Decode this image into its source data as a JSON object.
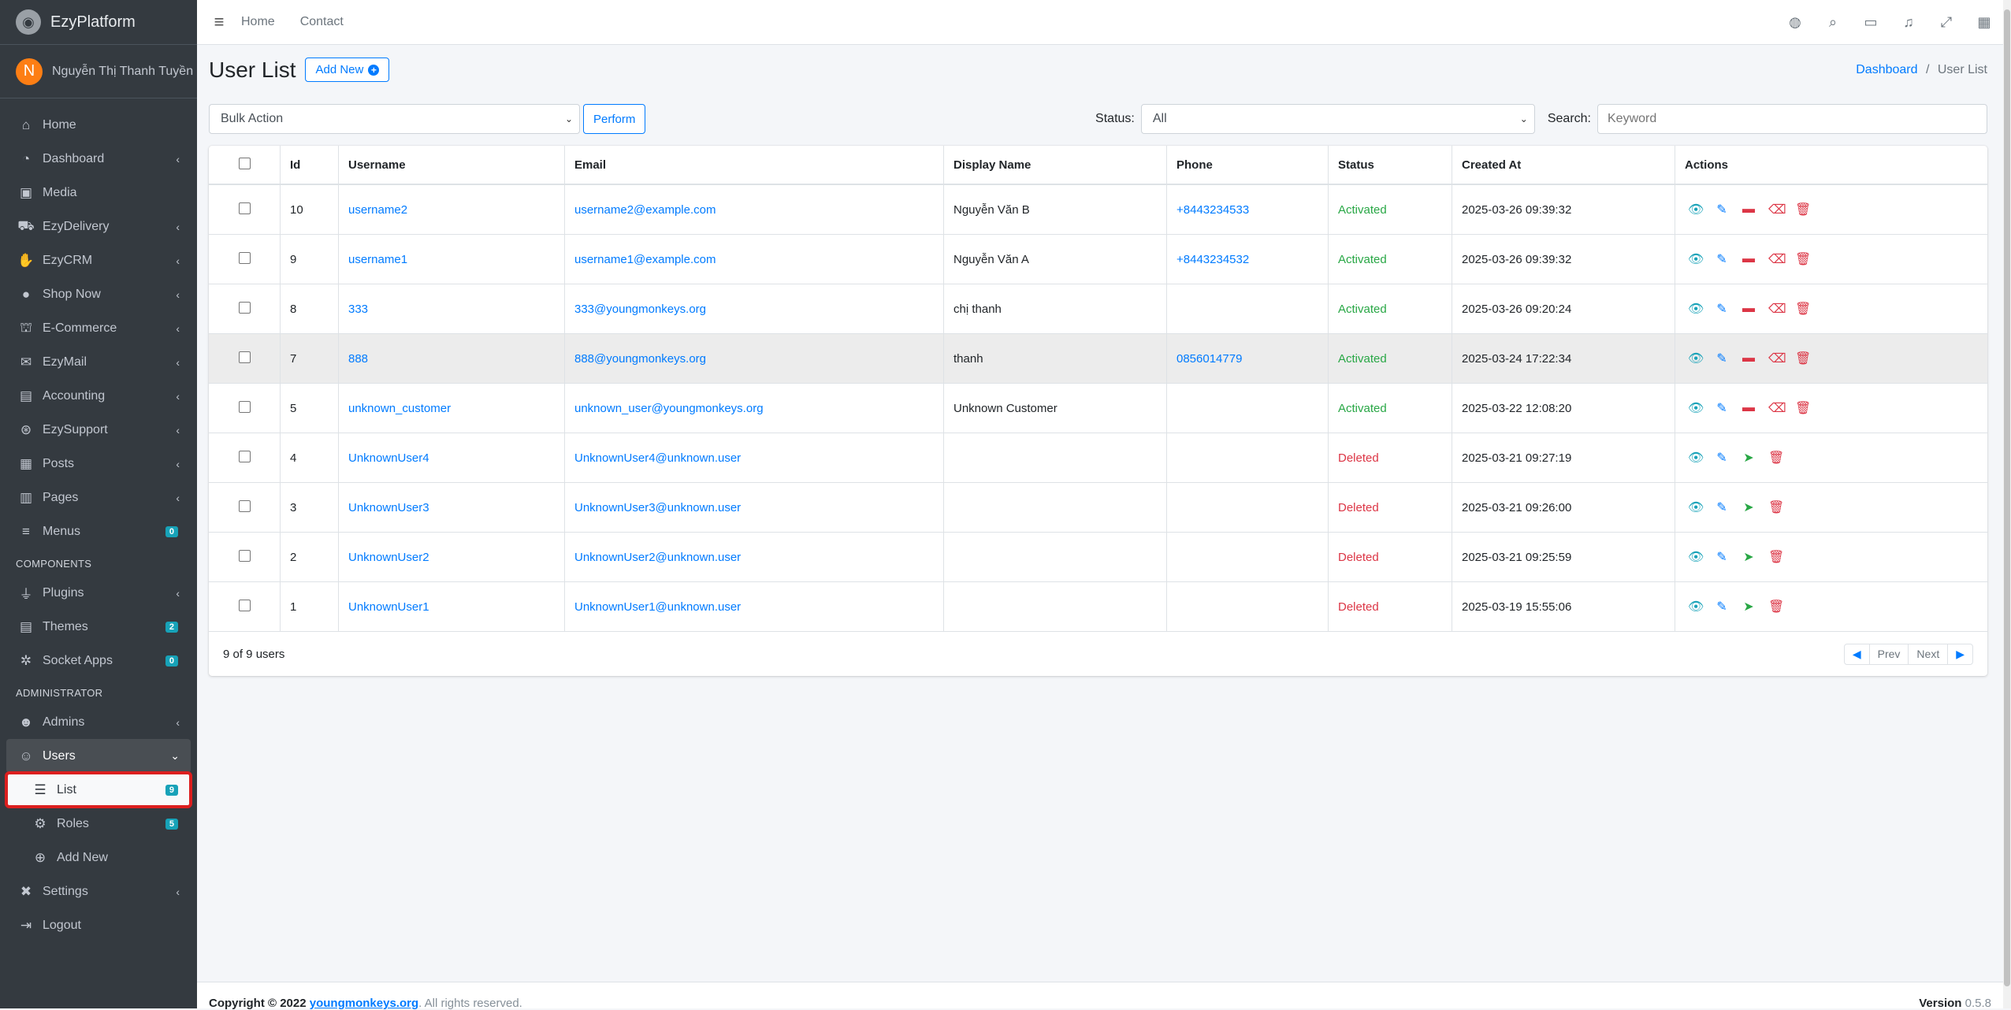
{
  "brand": {
    "name": "EzyPlatform"
  },
  "user": {
    "initial": "N",
    "name": "Nguyễn Thị Thanh Tuyền"
  },
  "sidebar": {
    "items": [
      {
        "label": "Home",
        "icon": "home-icon"
      },
      {
        "label": "Dashboard",
        "icon": "dashboard-icon"
      },
      {
        "label": "Media",
        "icon": "media-icon"
      },
      {
        "label": "EzyDelivery",
        "icon": "truck-icon"
      },
      {
        "label": "EzyCRM",
        "icon": "handshake-icon"
      },
      {
        "label": "Shop Now",
        "icon": "circle-icon"
      },
      {
        "label": "E-Commerce",
        "icon": "basket-icon"
      },
      {
        "label": "EzyMail",
        "icon": "mail-icon"
      },
      {
        "label": "Accounting",
        "icon": "accounting-icon"
      },
      {
        "label": "EzySupport",
        "icon": "lifering-icon"
      },
      {
        "label": "Posts",
        "icon": "posts-icon"
      },
      {
        "label": "Pages",
        "icon": "pages-icon"
      },
      {
        "label": "Menus",
        "icon": "menu-icon",
        "badge": "0"
      }
    ],
    "components_header": "COMPONENTS",
    "components": [
      {
        "label": "Plugins",
        "icon": "plug-icon"
      },
      {
        "label": "Themes",
        "icon": "themes-icon",
        "badge": "2"
      },
      {
        "label": "Socket Apps",
        "icon": "socket-icon",
        "badge": "0"
      }
    ],
    "admin_header": "ADMINISTRATOR",
    "admin": [
      {
        "label": "Admins",
        "icon": "admin-user-icon"
      },
      {
        "label": "Users",
        "icon": "users-icon"
      }
    ],
    "users_sub": [
      {
        "label": "List",
        "icon": "list-icon",
        "badge": "9"
      },
      {
        "label": "Roles",
        "icon": "roles-icon",
        "badge": "5"
      },
      {
        "label": "Add New",
        "icon": "plus-circle-icon"
      }
    ],
    "bottom": [
      {
        "label": "Settings",
        "icon": "tools-icon"
      },
      {
        "label": "Logout",
        "icon": "logout-icon"
      }
    ]
  },
  "topbar": {
    "links": [
      "Home",
      "Contact"
    ]
  },
  "page": {
    "title": "User List",
    "add_new": "Add New",
    "breadcrumb": {
      "parent": "Dashboard",
      "separator": "/",
      "current": "User List"
    }
  },
  "filters": {
    "bulk_action": "Bulk Action",
    "perform": "Perform",
    "status_label": "Status:",
    "status_value": "All",
    "search_label": "Search:",
    "search_placeholder": "Keyword"
  },
  "table": {
    "headers": [
      "Id",
      "Username",
      "Email",
      "Display Name",
      "Phone",
      "Status",
      "Created At",
      "Actions"
    ],
    "rows": [
      {
        "id": "10",
        "username": "username2",
        "email": "username2@example.com",
        "display_name": "Nguyễn Văn B",
        "phone": "+8443234533",
        "status": "Activated",
        "created_at": "2025-03-26 09:39:32"
      },
      {
        "id": "9",
        "username": "username1",
        "email": "username1@example.com",
        "display_name": "Nguyễn Văn A",
        "phone": "+8443234532",
        "status": "Activated",
        "created_at": "2025-03-26 09:39:32"
      },
      {
        "id": "8",
        "username": "333",
        "email": "333@youngmonkeys.org",
        "display_name": "chị thanh",
        "phone": "",
        "status": "Activated",
        "created_at": "2025-03-26 09:20:24"
      },
      {
        "id": "7",
        "username": "888",
        "email": "888@youngmonkeys.org",
        "display_name": "thanh",
        "phone": "0856014779",
        "status": "Activated",
        "created_at": "2025-03-24 17:22:34"
      },
      {
        "id": "5",
        "username": "unknown_customer",
        "email": "unknown_user@youngmonkeys.org",
        "display_name": "Unknown Customer",
        "phone": "",
        "status": "Activated",
        "created_at": "2025-03-22 12:08:20"
      },
      {
        "id": "4",
        "username": "UnknownUser4",
        "email": "UnknownUser4@unknown.user",
        "display_name": "",
        "phone": "",
        "status": "Deleted",
        "created_at": "2025-03-21 09:27:19"
      },
      {
        "id": "3",
        "username": "UnknownUser3",
        "email": "UnknownUser3@unknown.user",
        "display_name": "",
        "phone": "",
        "status": "Deleted",
        "created_at": "2025-03-21 09:26:00"
      },
      {
        "id": "2",
        "username": "UnknownUser2",
        "email": "UnknownUser2@unknown.user",
        "display_name": "",
        "phone": "",
        "status": "Deleted",
        "created_at": "2025-03-21 09:25:59"
      },
      {
        "id": "1",
        "username": "UnknownUser1",
        "email": "UnknownUser1@unknown.user",
        "display_name": "",
        "phone": "",
        "status": "Deleted",
        "created_at": "2025-03-19 15:55:06"
      }
    ],
    "summary": "9 of 9 users",
    "prev": "Prev",
    "next": "Next"
  },
  "footer": {
    "copyright": "Copyright © 2022",
    "link": "youngmonkeys.org",
    "rights": ". All rights reserved.",
    "version_label": "Version",
    "version": "0.5.8"
  },
  "colors": {
    "sidebar": "#343a40",
    "primary": "#007bff",
    "activated": "#28a745",
    "deleted": "#dc3545"
  }
}
